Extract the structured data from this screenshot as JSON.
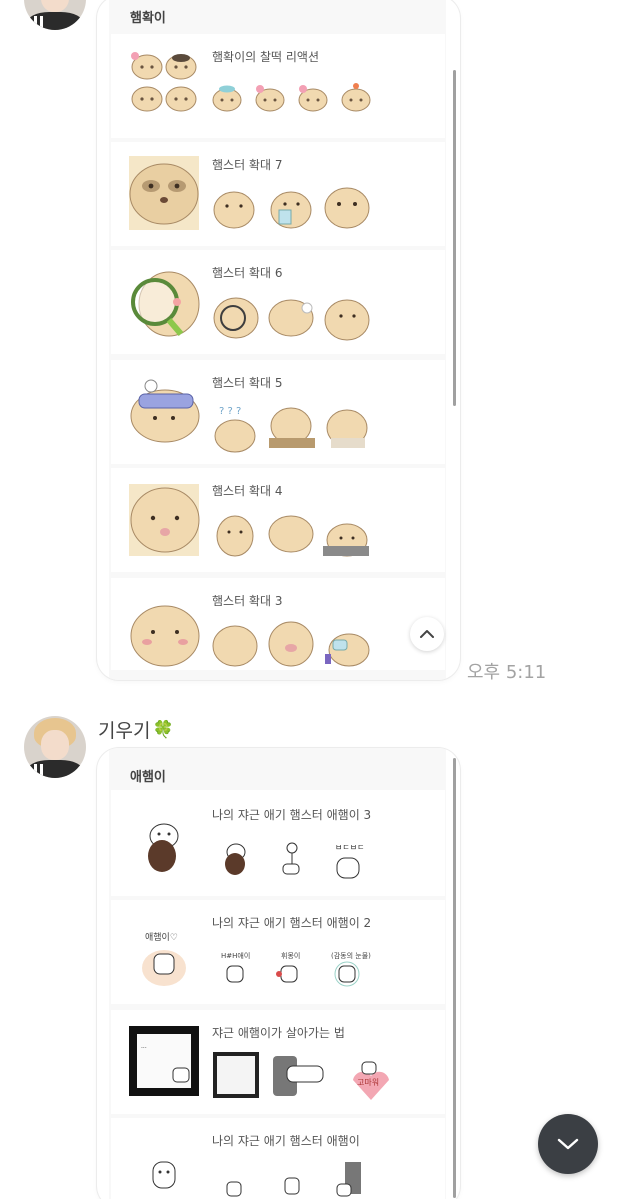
{
  "top_card": {
    "title": "햄확이",
    "rows": [
      {
        "title": "햄확이의 찰떡 리액션"
      },
      {
        "title": "햄스터 확대 7"
      },
      {
        "title": "햄스터 확대 6"
      },
      {
        "title": "햄스터 확대 5"
      },
      {
        "title": "햄스터 확대 4"
      },
      {
        "title": "햄스터 확대 3"
      }
    ]
  },
  "timestamp": "오후 5:11",
  "sender": {
    "name": "기우기",
    "emoji": "🍀"
  },
  "bottom_card": {
    "title": "애햄이",
    "rows": [
      {
        "title": "나의 쟈근 애기 햄스터 애햄이 3"
      },
      {
        "title": "나의 쟈근 애기 햄스터 애햄이 2"
      },
      {
        "title": "쟈근 애햄이가 살아가는 법"
      },
      {
        "title": "나의 쟈근 애기 햄스터 애햄이"
      }
    ]
  },
  "colors": {
    "hamster_fur": "#f1d9b0",
    "hamster_dark": "#c9a77a",
    "fab_bg": "#3b3f44",
    "timestamp": "#a3a3a3"
  },
  "icons": {
    "scroll_up": "chevron-up-icon",
    "scroll_down": "chevron-down-icon",
    "sender_emoji": "clover-icon"
  }
}
